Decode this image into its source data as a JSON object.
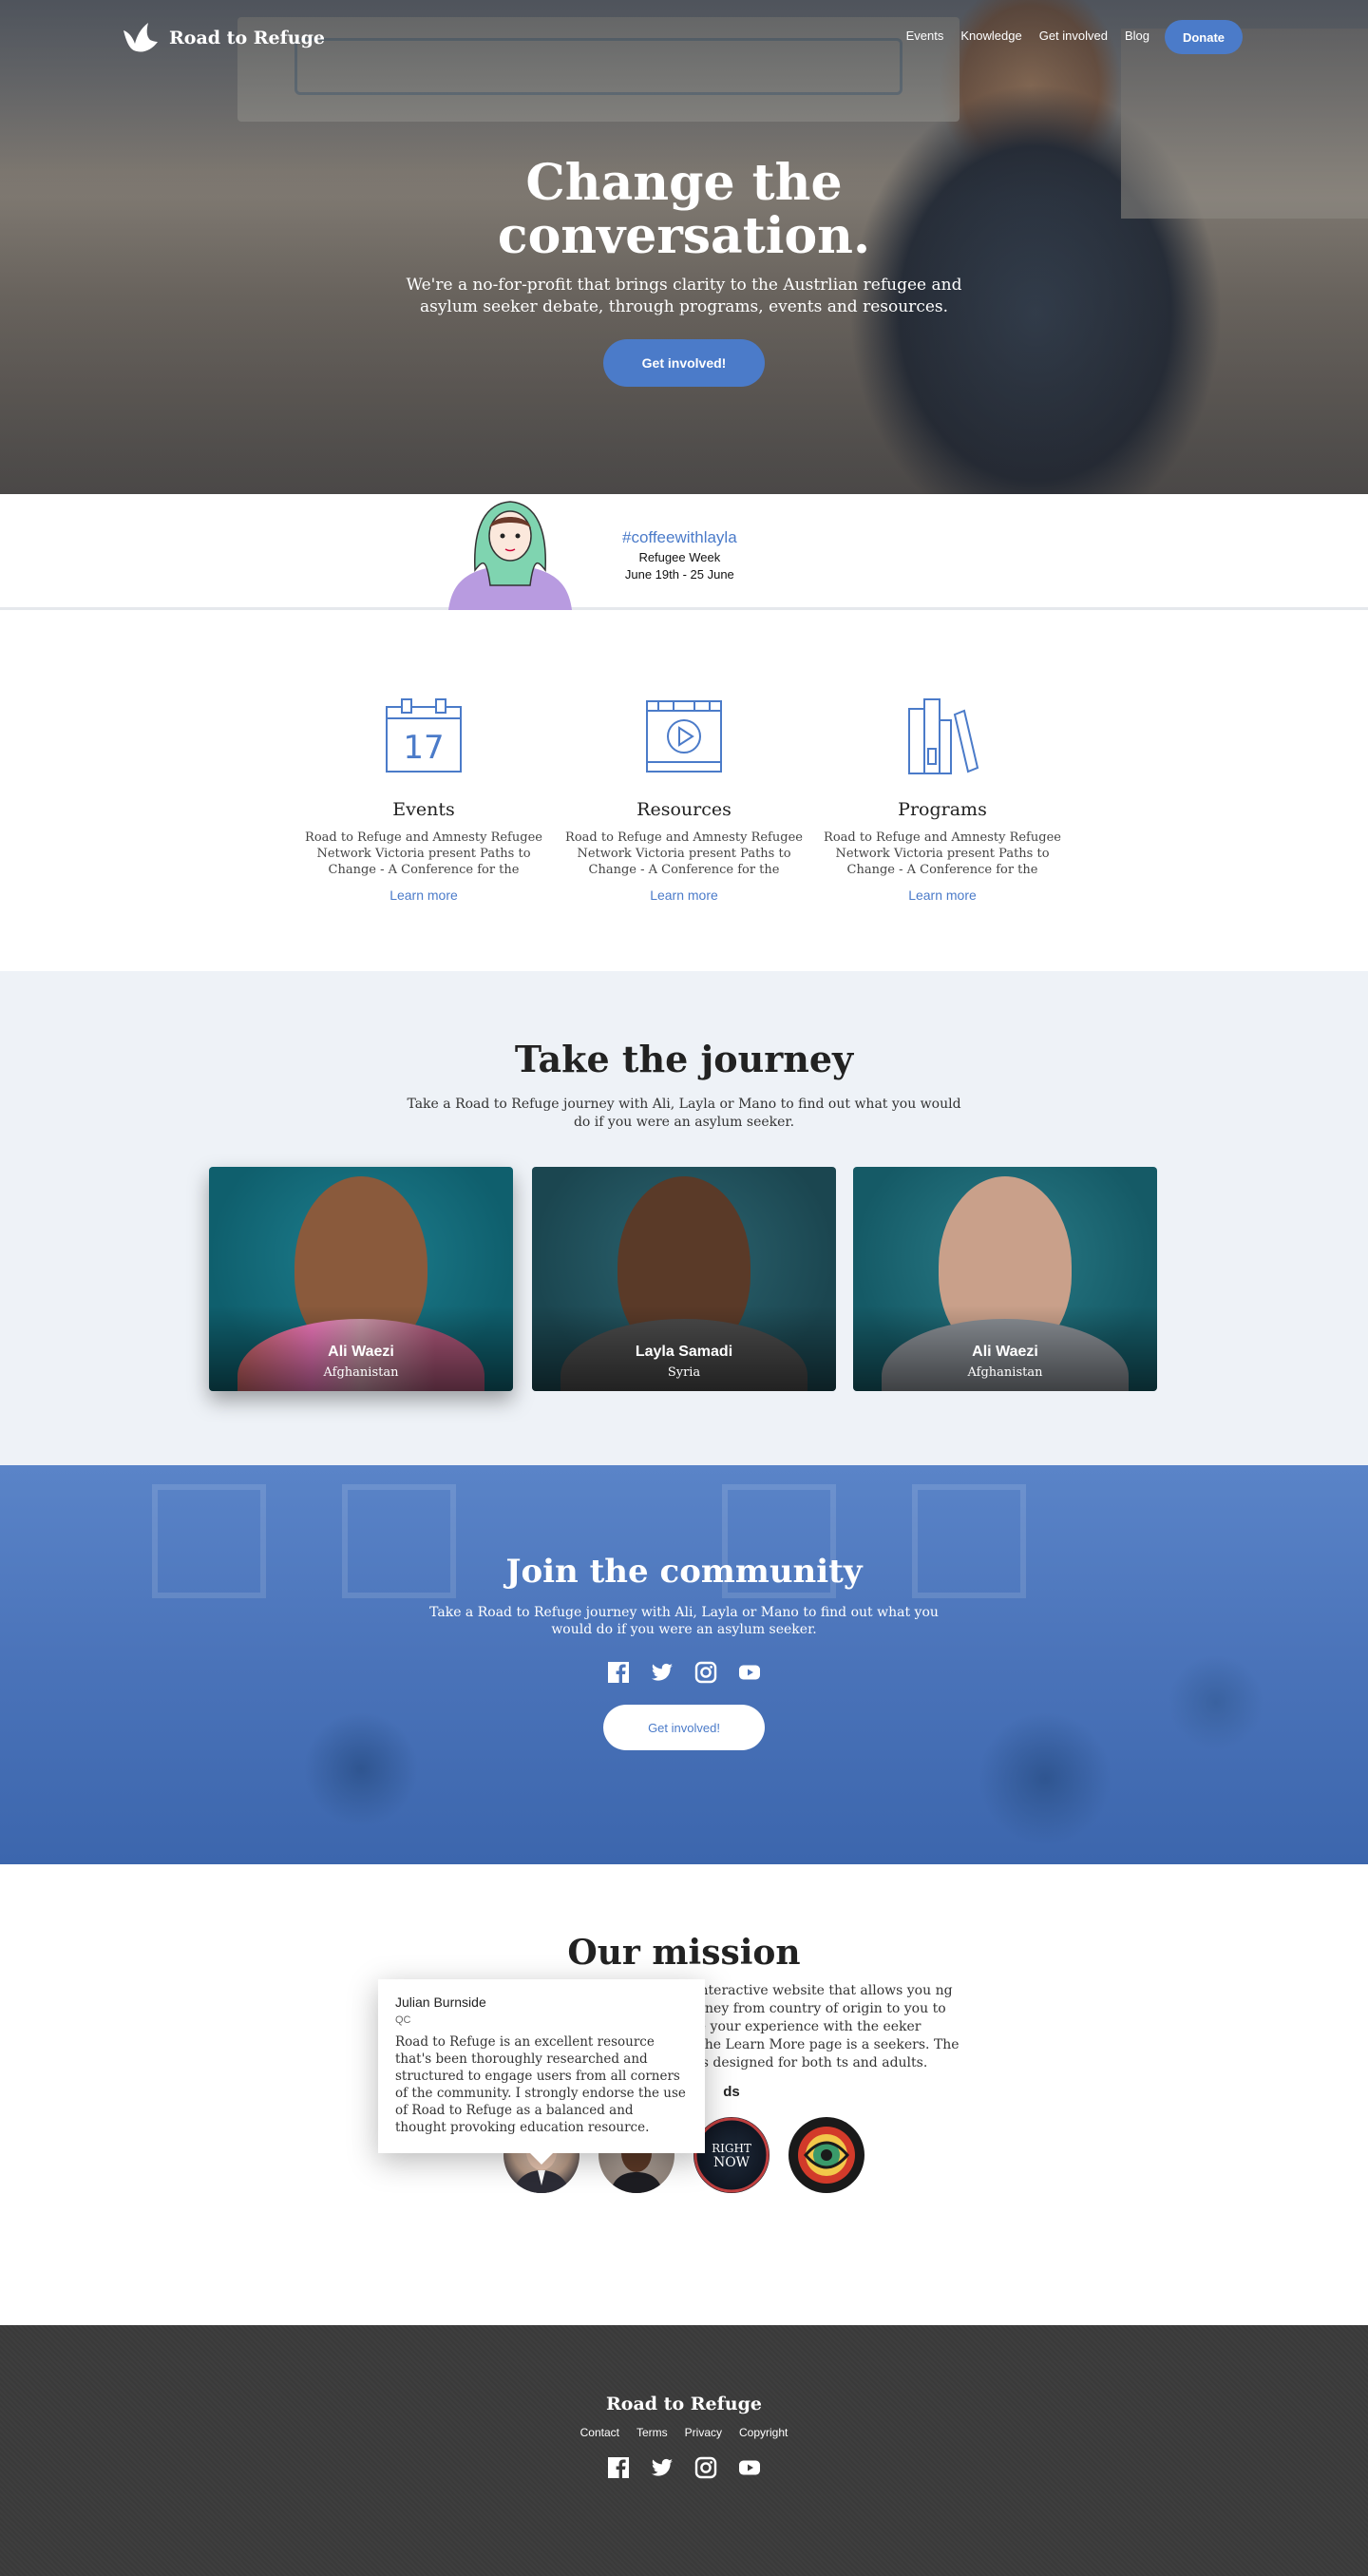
{
  "brand": {
    "name": "Road to Refuge"
  },
  "nav": {
    "items": [
      {
        "label": "Events"
      },
      {
        "label": "Knowledge"
      },
      {
        "label": "Get involved"
      },
      {
        "label": "Blog"
      }
    ],
    "donate_label": "Donate"
  },
  "hero": {
    "title": "Change the conversation.",
    "subtitle": "We're a no-for-profit that brings clarity to the Austrlian refugee and asylum seeker debate, through programs, events and resources.",
    "cta_label": "Get involved!"
  },
  "banner": {
    "hashtag": "#coffeewithlayla",
    "line1": "Refugee Week",
    "line2": "June 19th - 25 June"
  },
  "features": [
    {
      "icon": "calendar-icon",
      "icon_text": "17",
      "title": "Events",
      "text": "Road to Refuge and Amnesty Refugee Network Victoria present Paths to Change - A Conference for the",
      "link": "Learn more"
    },
    {
      "icon": "video-icon",
      "title": "Resources",
      "text": "Road to Refuge and Amnesty Refugee Network Victoria present Paths to Change - A Conference for the",
      "link": "Learn more"
    },
    {
      "icon": "books-icon",
      "title": "Programs",
      "text": "Road to Refuge and Amnesty Refugee Network Victoria present Paths to Change - A Conference for the",
      "link": "Learn more"
    }
  ],
  "journey": {
    "title": "Take the journey",
    "text": "Take a Road to Refuge journey with Ali, Layla or Mano to find out what you would do if you were an asylum seeker.",
    "cards": [
      {
        "name": "Ali Waezi",
        "country": "Afghanistan"
      },
      {
        "name": "Layla Samadi",
        "country": "Syria"
      },
      {
        "name": "Ali Waezi",
        "country": "Afghanistan"
      }
    ]
  },
  "community": {
    "title": "Join the community",
    "text": "Take a Road to Refuge journey with Ali, Layla or Mano to find out what you would do if you were an asylum seeker.",
    "cta_label": "Get involved!",
    "socials": [
      "facebook-icon",
      "twitter-icon",
      "instagram-icon",
      "youtube-icon"
    ]
  },
  "mission": {
    "title": "Our mission",
    "text": "nal and interactive website that allows you ng their journey from country of origin to you to juxtapose your experience with the eeker debate. The Learn More page is a seekers. The website is designed for both ts and adults.",
    "endorsed_label": "ds",
    "avatar_badge": "RIGHT NOW",
    "tooltip": {
      "name": "Julian Burnside",
      "role": "QC",
      "quote": "Road to Refuge is an excellent resource that's been thoroughly researched and structured to engage users from all corners of the community. I strongly endorse the use of Road to Refuge as a balanced and thought provoking education resource."
    }
  },
  "footer": {
    "title": "Road to Refuge",
    "links": [
      {
        "label": "Contact"
      },
      {
        "label": "Terms"
      },
      {
        "label": "Privacy"
      },
      {
        "label": "Copyright"
      }
    ]
  },
  "colors": {
    "accent": "#4b7bc9",
    "footer": "#3a3a3a",
    "journey_bg": "#eef2f7"
  }
}
